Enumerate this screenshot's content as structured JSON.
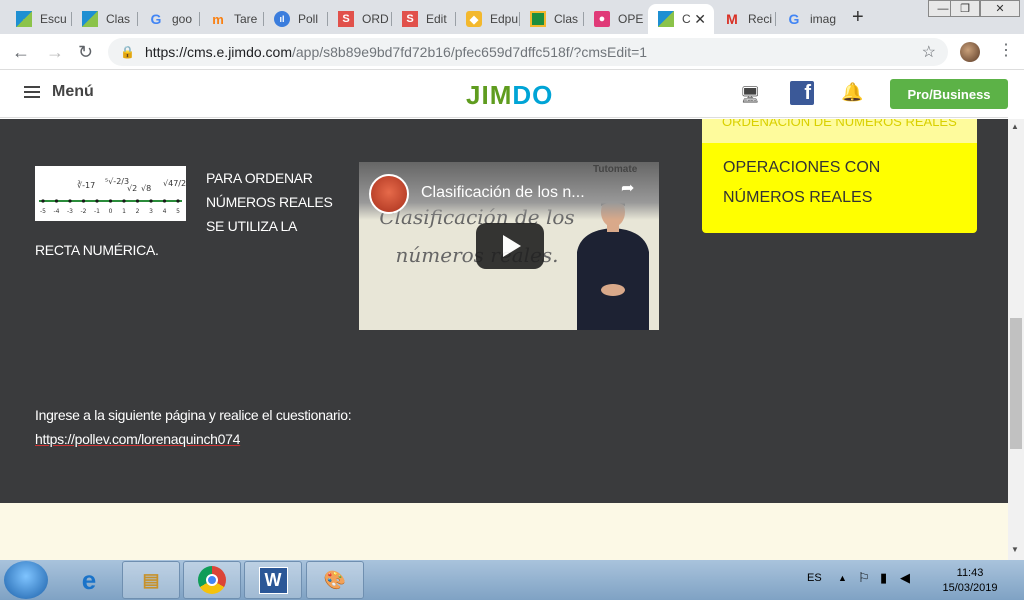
{
  "tabs": [
    {
      "label": "Escu",
      "icon": "jimdo-icon",
      "color": "#1e8fd2"
    },
    {
      "label": "Clas",
      "icon": "jimdo-icon",
      "color": "#1e8fd2"
    },
    {
      "label": "goo",
      "icon": "google-icon",
      "color": "#4285f4"
    },
    {
      "label": "Tare",
      "icon": "moodle-icon",
      "color": "#f98012"
    },
    {
      "label": "Poll",
      "icon": "pollev-icon",
      "color": "#3b7ddd"
    },
    {
      "label": "ORD",
      "icon": "s-icon",
      "color": "#e1514b"
    },
    {
      "label": "Edit",
      "icon": "s-icon",
      "color": "#e1514b"
    },
    {
      "label": "Edpu",
      "icon": "edpuzzle-icon",
      "color": "#f3b82d"
    },
    {
      "label": "Clas",
      "icon": "classroom-icon",
      "color": "#1e8e3e"
    },
    {
      "label": "OPE",
      "icon": "ope-icon",
      "color": "#e03a78"
    },
    {
      "label": "C",
      "icon": "jimdo-icon",
      "color": "#1e8fd2"
    },
    {
      "label": "Reci",
      "icon": "gmail-icon",
      "color": "#d93025"
    },
    {
      "label": "imag",
      "icon": "google-icon",
      "color": "#4285f4"
    }
  ],
  "browser": {
    "url_host": "https://cms.e.jimdo.com",
    "url_path": "/app/s8b89e9bd7fd72b16/pfec659d7dffc518f/?cmsEdit=1"
  },
  "jimdo": {
    "menu_label": "Menú",
    "logo_left": "JI",
    "logo_mid": "M",
    "logo_right": "DO",
    "pro_button": "Pro/Business"
  },
  "content": {
    "para1": "PARA ORDENAR NÚMEROS REALES SE UTILIZA LA RECTA NUMÉRICA.",
    "numberline_ticks": [
      "-5",
      "-4",
      "-3",
      "-2",
      "-1",
      "0",
      "1",
      "2",
      "3",
      "4",
      "5"
    ],
    "video_title": "Clasificación de los n...",
    "video_brand": "Tutomate",
    "video_board_text": "Clasificación de los números reales.",
    "sidebar_faded": "ORDENACIÓN DE NÚMEROS REALES",
    "sidebar_link": "OPERACIONES CON NÚMEROS REALES",
    "para2": "Ingrese a la siguiente página y realice el cuestionario:",
    "link": "https://pollev.com/lorenaquinch074"
  },
  "taskbar": {
    "lang": "ES",
    "time": "11:43",
    "date": "15/03/2019"
  },
  "colors": {
    "content_bg": "#3a3b3d",
    "sidebar_yellow": "#ffff00",
    "pro_green": "#5cb247",
    "footer_bg": "#fcf9e6"
  }
}
